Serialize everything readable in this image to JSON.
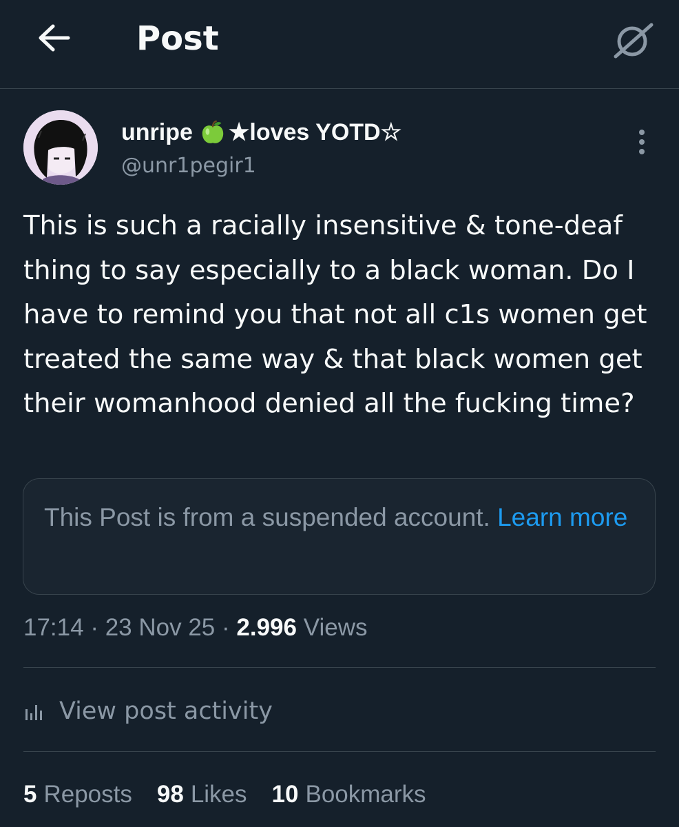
{
  "header": {
    "title": "Post",
    "back_icon": "arrow-left-icon",
    "grok_icon": "grok-icon"
  },
  "post": {
    "author": {
      "display_name_prefix": "unripe",
      "display_name_emoji": "🍏",
      "display_name_suffix": "★loves YOTD☆",
      "handle": "@unr1pegir1"
    },
    "text": "This is such a racially insensitive & tone-deaf thing to say especially to a black woman. Do I have to remind you that not all c1s women get treated the same way & that black women get their womanhood denied all the fucking time?",
    "suspended_notice": {
      "text": "This Post is from a suspended account. ",
      "link": "Learn more"
    },
    "meta": {
      "time": "17:14",
      "separator": "·",
      "date": "23 Nov 25",
      "views_count": "2.996",
      "views_label": "Views"
    },
    "activity_label": "View post activity",
    "stats": [
      {
        "count": "5",
        "label": "Reposts"
      },
      {
        "count": "98",
        "label": "Likes"
      },
      {
        "count": "10",
        "label": "Bookmarks"
      }
    ]
  },
  "colors": {
    "background": "#15202b",
    "primary_text": "#f7f9f9",
    "secondary_text": "#8b98a5",
    "link": "#1d9bf0",
    "border": "#38444d"
  }
}
